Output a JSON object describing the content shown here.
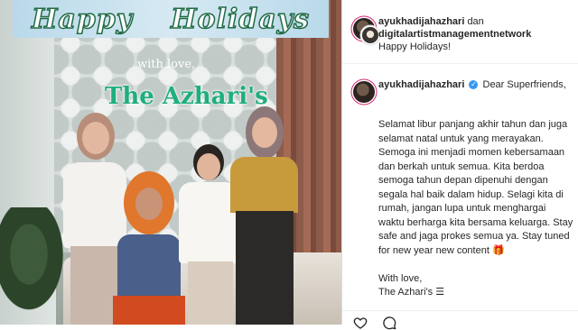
{
  "photo": {
    "banner_word_1": "Happy",
    "banner_word_2": "Holidays",
    "with_love": "with love,",
    "family_name": "The Azhari's"
  },
  "post": {
    "header": {
      "author": "ayukhadijahazhari",
      "connector": "dan",
      "collaborator": "digitalartistmanagementnetwork",
      "subtitle": "Happy Holidays!"
    },
    "caption": {
      "author": "ayukhadijahazhari",
      "greeting": "Dear Superfriends,",
      "body": "Selamat libur panjang akhir tahun dan juga selamat natal untuk yang merayakan. Semoga ini menjadi momen kebersamaan dan berkah untuk semua. Kita berdoa semoga tahun depan dipenuhi dengan segala hal baik dalam hidup. Selagi kita di rumah, jangan lupa untuk menghargai waktu berharga kita bersama keluarga. Stay safe and jaga prokes semua ya. Stay tuned for new year new content 🎁",
      "signoff": "With love,",
      "signature": "The Azhari's ☰"
    },
    "actions": {
      "like_icon": "heart-icon",
      "comment_icon": "comment-icon"
    }
  },
  "colors": {
    "accent_ring": "#d62976",
    "verified": "#3897f0",
    "family_name": "#1fae7f",
    "banner_stroke": "#1f6b45"
  }
}
